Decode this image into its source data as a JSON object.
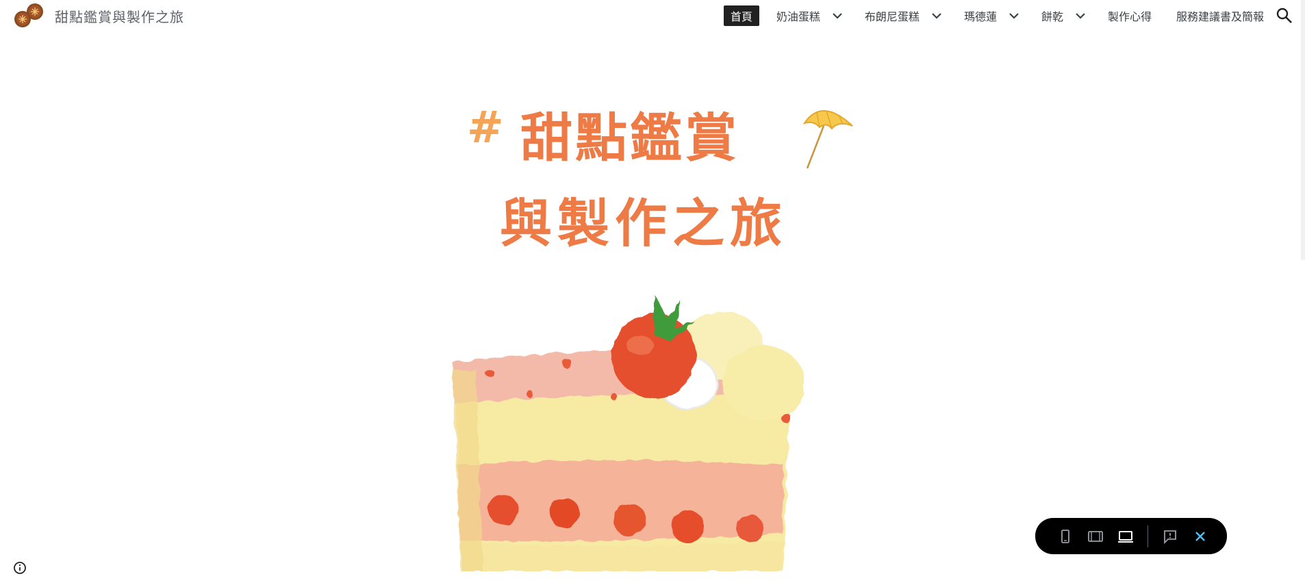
{
  "site": {
    "title": "甜點鑑賞與製作之旅"
  },
  "nav": {
    "items": [
      {
        "label": "首頁",
        "active": true,
        "has_dropdown": false
      },
      {
        "label": "奶油蛋糕",
        "active": false,
        "has_dropdown": true
      },
      {
        "label": "布朗尼蛋糕",
        "active": false,
        "has_dropdown": true
      },
      {
        "label": "瑪德蓮",
        "active": false,
        "has_dropdown": true
      },
      {
        "label": "餅乾",
        "active": false,
        "has_dropdown": true
      },
      {
        "label": "製作心得",
        "active": false,
        "has_dropdown": false
      },
      {
        "label": "服務建議書及簡報",
        "active": false,
        "has_dropdown": false
      }
    ],
    "search_icon": "search-icon"
  },
  "hero": {
    "hash": "#",
    "line1": "甜點鑑賞",
    "line2": "與製作之旅",
    "decoration_icon": "umbrella-icon",
    "image": "strawberry-cake-slice-illustration"
  },
  "preview_toolbar": {
    "buttons": [
      "phone-view-icon",
      "tablet-view-icon",
      "laptop-view-icon",
      "report-icon",
      "close-icon"
    ]
  },
  "colors": {
    "title_orange": "#ee7a45",
    "hash_orange": "#f3a457",
    "nav_active_bg": "#212121",
    "toolbar_bg": "#000000",
    "close_blue": "#4fc3f7"
  }
}
